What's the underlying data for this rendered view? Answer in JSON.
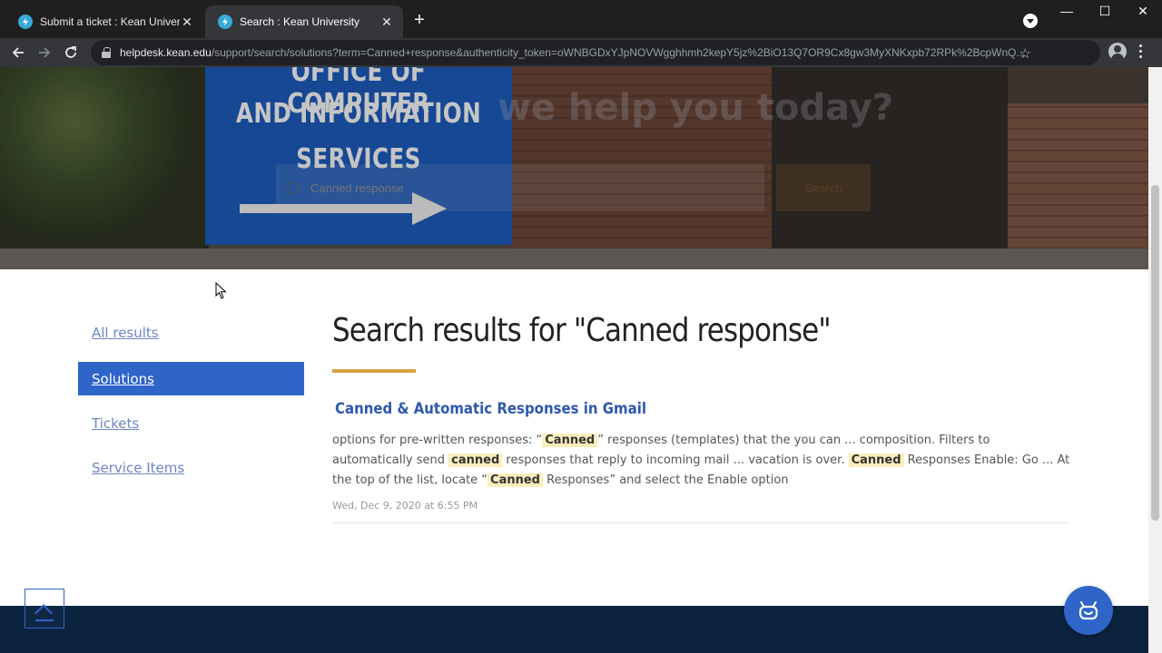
{
  "browser": {
    "tabs": [
      {
        "title": "Submit a ticket : Kean University",
        "active": false
      },
      {
        "title": "Search : Kean University",
        "active": true
      }
    ],
    "new_tab_label": "+",
    "url_host": "helpdesk.kean.edu",
    "url_path": "/support/search/solutions?term=Canned+response&authenticity_token=oWNBGDxYJpNOVWgghhmh2kepY5jz%2BiO13Q7OR9Cx8gw3MyXNKxpb72RPk%2BcpWnQ..."
  },
  "hero": {
    "sign_lines": [
      "OFFICE OF COMPUTER",
      "AND INFORMATION",
      "SERVICES"
    ],
    "heading": "we help you today?",
    "search_placeholder": "Canned response",
    "search_button": "Search"
  },
  "sidebar": {
    "items": [
      {
        "label": "All results",
        "active": false
      },
      {
        "label": "Solutions",
        "active": true
      },
      {
        "label": "Tickets",
        "active": false
      },
      {
        "label": "Service Items",
        "active": false
      }
    ]
  },
  "results": {
    "heading": "Search results for \"Canned response\"",
    "items": [
      {
        "title": "Canned & Automatic Responses in Gmail",
        "snippet_parts": [
          {
            "text": "options for pre-written responses:  “",
            "hl": false
          },
          {
            "text": "Canned",
            "hl": true
          },
          {
            "text": "” responses (templates) that the you can ... composition.  Filters to automatically send ",
            "hl": false
          },
          {
            "text": "canned",
            "hl": true
          },
          {
            "text": " responses that reply to incoming mail ... vacation is over.  ",
            "hl": false
          },
          {
            "text": "Canned",
            "hl": true
          },
          {
            "text": " Responses  Enable:  Go ... At the top of the list, locate “",
            "hl": false
          },
          {
            "text": "Canned",
            "hl": true
          },
          {
            "text": " Responses” and select the Enable option",
            "hl": false
          }
        ],
        "date": "Wed, Dec 9, 2020 at 6:55 PM"
      }
    ]
  },
  "colors": {
    "accent": "#2f65c9",
    "link": "#2f58b0",
    "underline": "#d8a23f",
    "highlight": "#fbeebc",
    "footer": "#0c2340"
  }
}
